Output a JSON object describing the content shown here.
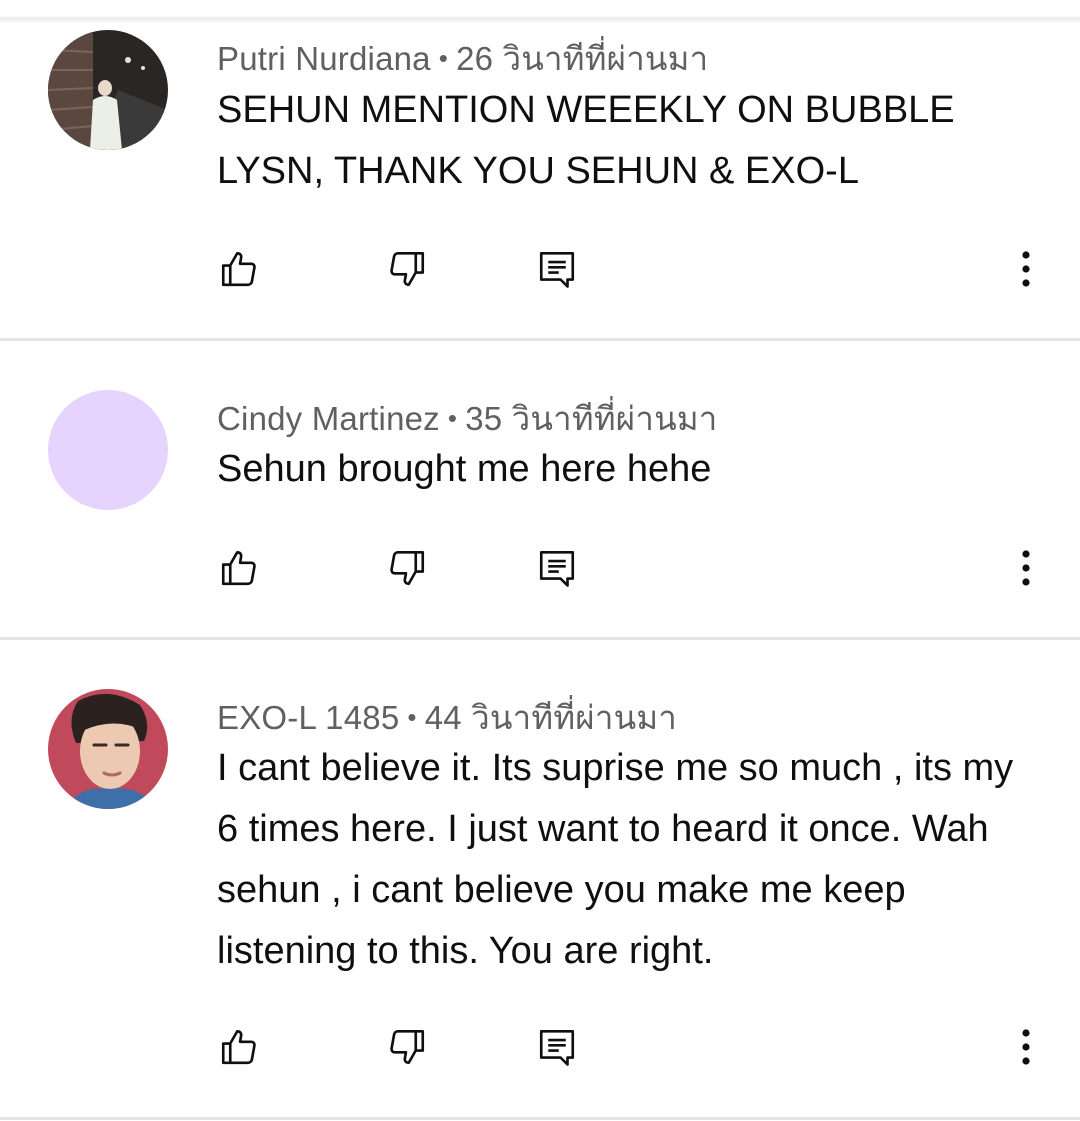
{
  "comments": [
    {
      "author": "Putri Nurdiana",
      "time": "26 วินาทีที่ผ่านมา",
      "text": "SEHUN MENTION WEEEKLY ON BUBBLE LYSN, THANK YOU SEHUN & EXO-L",
      "avatar": "photo-avatar-night-street"
    },
    {
      "author": "Cindy Martinez",
      "time": "35 วินาทีที่ผ่านมา",
      "text": "Sehun brought me here hehe",
      "avatar": "plain-lavender-avatar",
      "avatar_color": "#e6d3fe"
    },
    {
      "author": "EXO-L 1485",
      "time": "44 วินาทีที่ผ่านมา",
      "text": "I cant believe it. Its suprise me so much , its my 6 times here. I just want to heard it once. Wah sehun , i cant believe you make me keep listening to this. You are right.",
      "avatar": "photo-avatar-portrait-red"
    }
  ],
  "separator": "•",
  "actions": {
    "like_icon": "thumbs-up-icon",
    "dislike_icon": "thumbs-down-icon",
    "reply_icon": "reply-icon",
    "more_icon": "more-vertical-icon"
  }
}
